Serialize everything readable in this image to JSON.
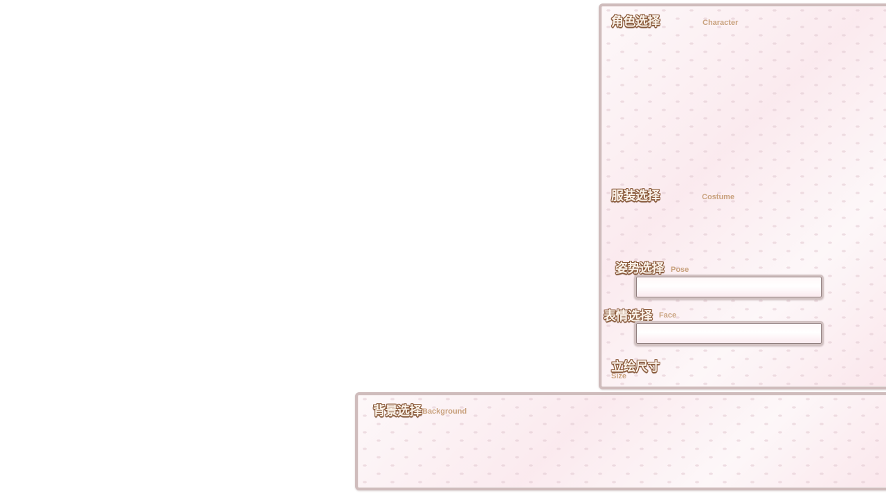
{
  "character": {
    "title": "角色选择",
    "subtitle": "Character"
  },
  "costume": {
    "title": "服装选择",
    "subtitle": "Costume"
  },
  "pose": {
    "title": "姿势选择",
    "subtitle": "Pose",
    "value": ""
  },
  "face": {
    "title": "表情选择",
    "subtitle": "Face",
    "value": ""
  },
  "size": {
    "title": "立绘尺寸",
    "subtitle": "Size"
  },
  "background": {
    "title": "背景选择",
    "subtitle": "Background"
  }
}
